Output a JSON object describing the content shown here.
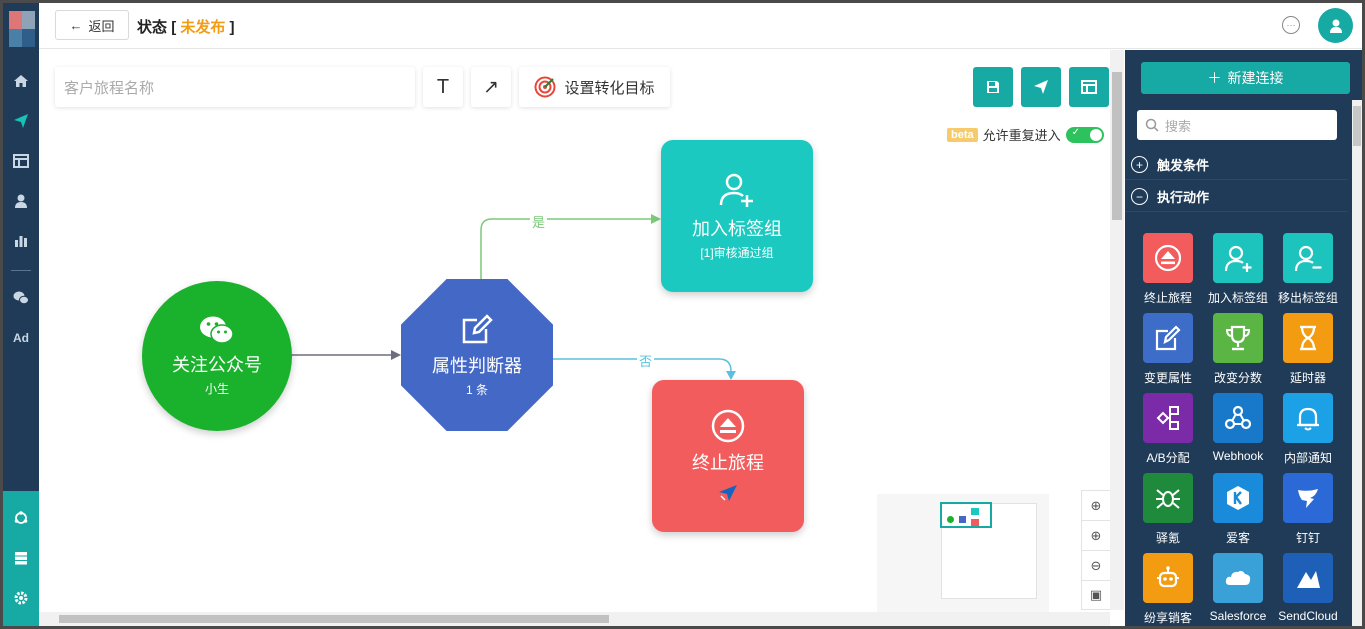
{
  "header": {
    "back_label": "返回",
    "title": "状态",
    "status_open": "[",
    "status": "未发布",
    "status_close": "]"
  },
  "toolbar": {
    "name_placeholder": "客户旅程名称",
    "text_tool": "T",
    "arrow_tool": "↗",
    "goal_label": "设置转化目标"
  },
  "options": {
    "beta": "beta",
    "reentry_label": "允许重复进入",
    "reentry_enabled": true
  },
  "flow": {
    "start_node": {
      "title": "关注公众号",
      "subtitle": "小生"
    },
    "decision_node": {
      "title": "属性判断器",
      "subtitle": "1 条"
    },
    "tag_node": {
      "title": "加入标签组",
      "subtitle": "[1]审核通过组"
    },
    "end_node": {
      "title": "终止旅程"
    },
    "yes_label": "是",
    "no_label": "否"
  },
  "panel": {
    "new_connection": "新建连接",
    "search_placeholder": "搜索",
    "sections": [
      {
        "label": "触发条件",
        "icon": "plus-circle"
      },
      {
        "label": "执行动作",
        "icon": "minus-circle"
      }
    ],
    "tiles": [
      {
        "label": "终止旅程",
        "icon": "eject-icon",
        "color": "#f25c5c"
      },
      {
        "label": "加入标签组",
        "icon": "user-plus-icon",
        "color": "#1cc4bd"
      },
      {
        "label": "移出标签组",
        "icon": "user-minus-icon",
        "color": "#1cc4bd"
      },
      {
        "label": "变更属性",
        "icon": "edit-icon",
        "color": "#3e6cc9"
      },
      {
        "label": "改变分数",
        "icon": "trophy-icon",
        "color": "#5bb544"
      },
      {
        "label": "延时器",
        "icon": "hourglass-icon",
        "color": "#f39c12"
      },
      {
        "label": "A/B分配",
        "icon": "ab-icon",
        "color": "#7b2aa8"
      },
      {
        "label": "Webhook",
        "icon": "webhook-icon",
        "color": "#1878c9"
      },
      {
        "label": "内部通知",
        "icon": "bell-icon",
        "color": "#1da1e6"
      },
      {
        "label": "驿氪",
        "icon": "spider-icon",
        "color": "#1f8a3c"
      },
      {
        "label": "爱客",
        "icon": "k-icon",
        "color": "#1a8bdb"
      },
      {
        "label": "钉钉",
        "icon": "dingtalk-icon",
        "color": "#2b6ad6"
      },
      {
        "label": "纷享销客",
        "icon": "robot-icon",
        "color": "#f39c12"
      },
      {
        "label": "Salesforce",
        "icon": "cloud-icon",
        "color": "#3aa1d8"
      },
      {
        "label": "SendCloud",
        "icon": "sendcloud-icon",
        "color": "#1e5fb8"
      }
    ]
  }
}
